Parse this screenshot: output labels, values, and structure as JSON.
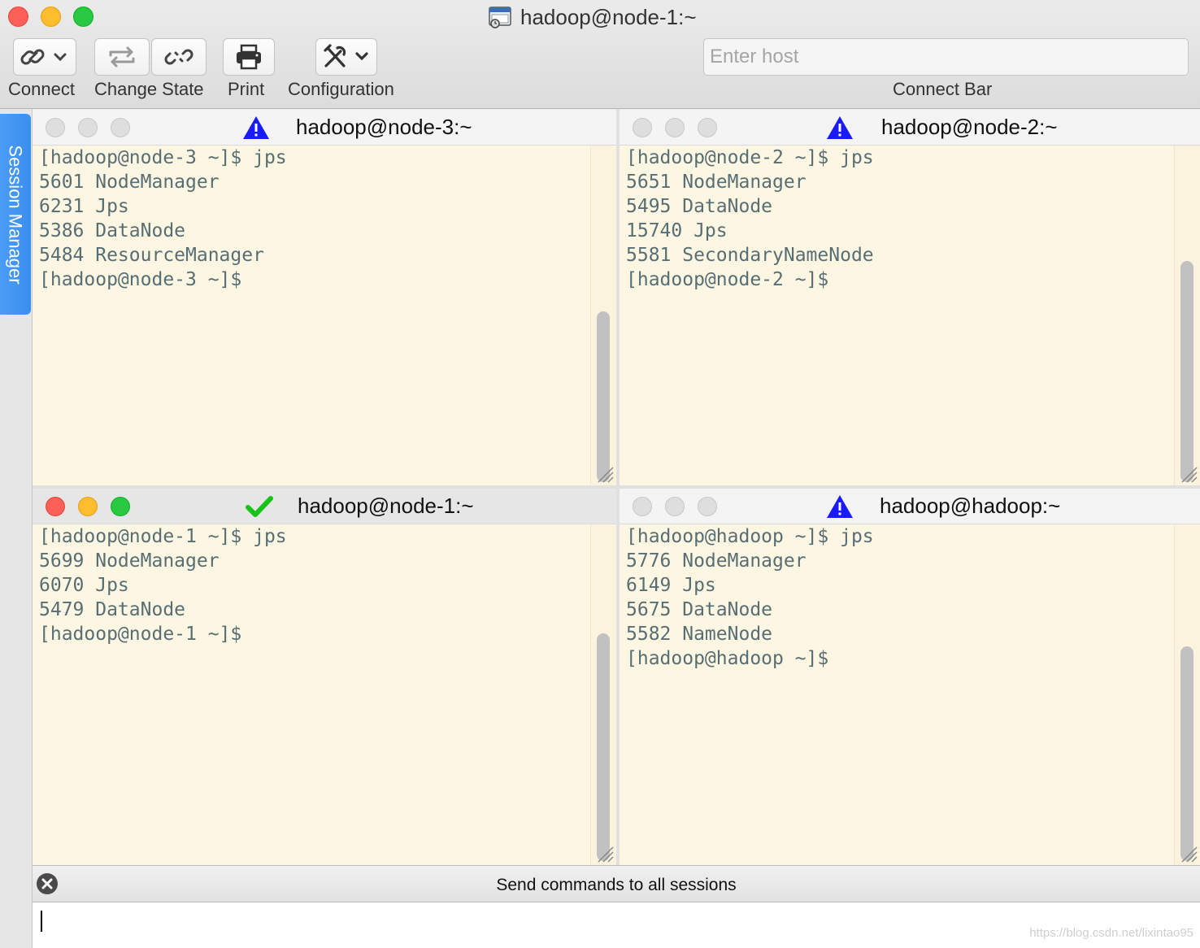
{
  "window": {
    "title": "hadoop@node-1:~"
  },
  "toolbar": {
    "connect_label": "Connect",
    "change_state_label": "Change State",
    "print_label": "Print",
    "configuration_label": "Configuration",
    "connect_bar_label": "Connect Bar",
    "host_placeholder": "Enter host",
    "host_value": ""
  },
  "sidebar": {
    "session_manager_label": "Session Manager"
  },
  "panes": [
    {
      "title": "hadoop@node-3:~",
      "status_icon": "warning-icon",
      "lines": [
        "[hadoop@node-3 ~]$ jps",
        "5601 NodeManager",
        "6231 Jps",
        "5386 DataNode",
        "5484 ResourceManager",
        "[hadoop@node-3 ~]$"
      ]
    },
    {
      "title": "hadoop@node-2:~",
      "status_icon": "warning-icon",
      "lines": [
        "[hadoop@node-2 ~]$ jps",
        "5651 NodeManager",
        "5495 DataNode",
        "15740 Jps",
        "5581 SecondaryNameNode",
        "[hadoop@node-2 ~]$"
      ]
    },
    {
      "title": "hadoop@node-1:~",
      "status_icon": "checkmark-icon",
      "lines": [
        "[hadoop@node-1 ~]$ jps",
        "5699 NodeManager",
        "6070 Jps",
        "5479 DataNode",
        "[hadoop@node-1 ~]$"
      ]
    },
    {
      "title": "hadoop@hadoop:~",
      "status_icon": "warning-icon",
      "lines": [
        "[hadoop@hadoop ~]$ jps",
        "5776 NodeManager",
        "6149 Jps",
        "5675 DataNode",
        "5582 NameNode",
        "[hadoop@hadoop ~]$"
      ]
    }
  ],
  "send_bar": {
    "label": "Send commands to all sessions",
    "value": ""
  },
  "watermark": "https://blog.csdn.net/lixintao95",
  "colors": {
    "terminal_bg": "#fdf6e3",
    "terminal_text": "#586e75",
    "session_tab": "#3a8ef0",
    "warning": "#1a1aff",
    "check": "#16c316"
  }
}
